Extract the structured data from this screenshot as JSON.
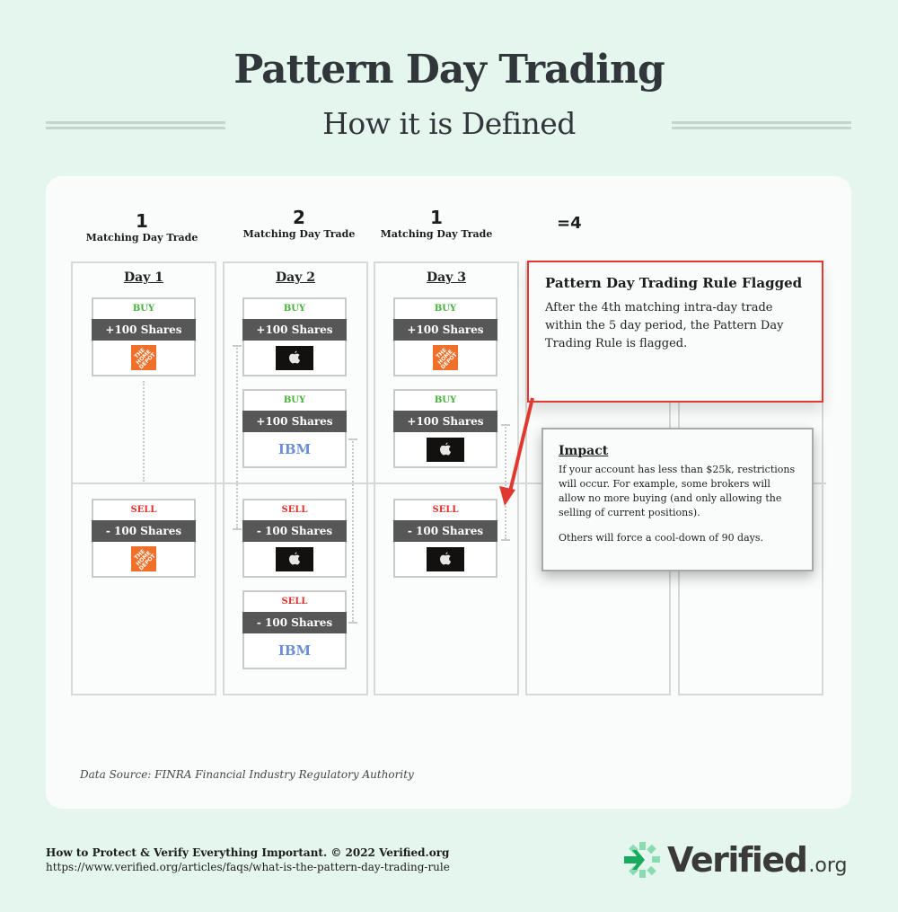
{
  "header": {
    "title": "Pattern Day Trading",
    "subtitle": "How it is Defined"
  },
  "counts": [
    {
      "number": "1",
      "label": "Matching Day Trade"
    },
    {
      "number": "2",
      "label": "Matching Day Trade"
    },
    {
      "number": "1",
      "label": "Matching Day Trade"
    }
  ],
  "total": "=4",
  "days": [
    {
      "label": "Day 1"
    },
    {
      "label": "Day 2"
    },
    {
      "label": "Day 3"
    }
  ],
  "trades": {
    "day1": [
      {
        "action": "BUY",
        "qty": "+100 Shares",
        "logo": "home-depot-logo",
        "logo_text": "THE HOME DEPOT"
      },
      {
        "action": "SELL",
        "qty": "- 100 Shares",
        "logo": "home-depot-logo",
        "logo_text": "THE HOME DEPOT"
      }
    ],
    "day2": [
      {
        "action": "BUY",
        "qty": "+100 Shares",
        "logo": "apple-logo"
      },
      {
        "action": "BUY",
        "qty": "+100 Shares",
        "logo": "ibm-logo",
        "logo_text": "IBM"
      },
      {
        "action": "SELL",
        "qty": "- 100 Shares",
        "logo": "apple-logo"
      },
      {
        "action": "SELL",
        "qty": "- 100 Shares",
        "logo": "ibm-logo",
        "logo_text": "IBM"
      }
    ],
    "day3": [
      {
        "action": "BUY",
        "qty": "+100 Shares",
        "logo": "home-depot-logo",
        "logo_text": "THE HOME DEPOT"
      },
      {
        "action": "BUY",
        "qty": "+100 Shares",
        "logo": "apple-logo"
      },
      {
        "action": "SELL",
        "qty": "- 100 Shares",
        "logo": "apple-logo"
      }
    ]
  },
  "flag": {
    "title": "Pattern Day Trading Rule Flagged",
    "body": "After the 4th matching intra-day trade within the 5 day period, the Pattern Day Trading Rule is flagged.",
    "color": "#e1392f"
  },
  "impact": {
    "title": "Impact",
    "body1": "If your account has less than $25k, restrictions will occur. For example, some brokers will allow no more buying (and only allowing the selling of current positions).",
    "body2": "Others will force a cool-down of 90 days."
  },
  "source": "Data Source: FINRA Financial Industry Regulatory Authority",
  "footer": {
    "tagline": "How to Protect & Verify Everything Important. © 2022 Verified.org",
    "url": "https://www.verified.org/articles/faqs/what-is-the-pattern-day-trading-rule",
    "brand": "Verified",
    "brand_tld": ".org"
  },
  "colors": {
    "buy": "#44b23a",
    "sell": "#e0322a",
    "brand_green": "#1aaa5e"
  }
}
